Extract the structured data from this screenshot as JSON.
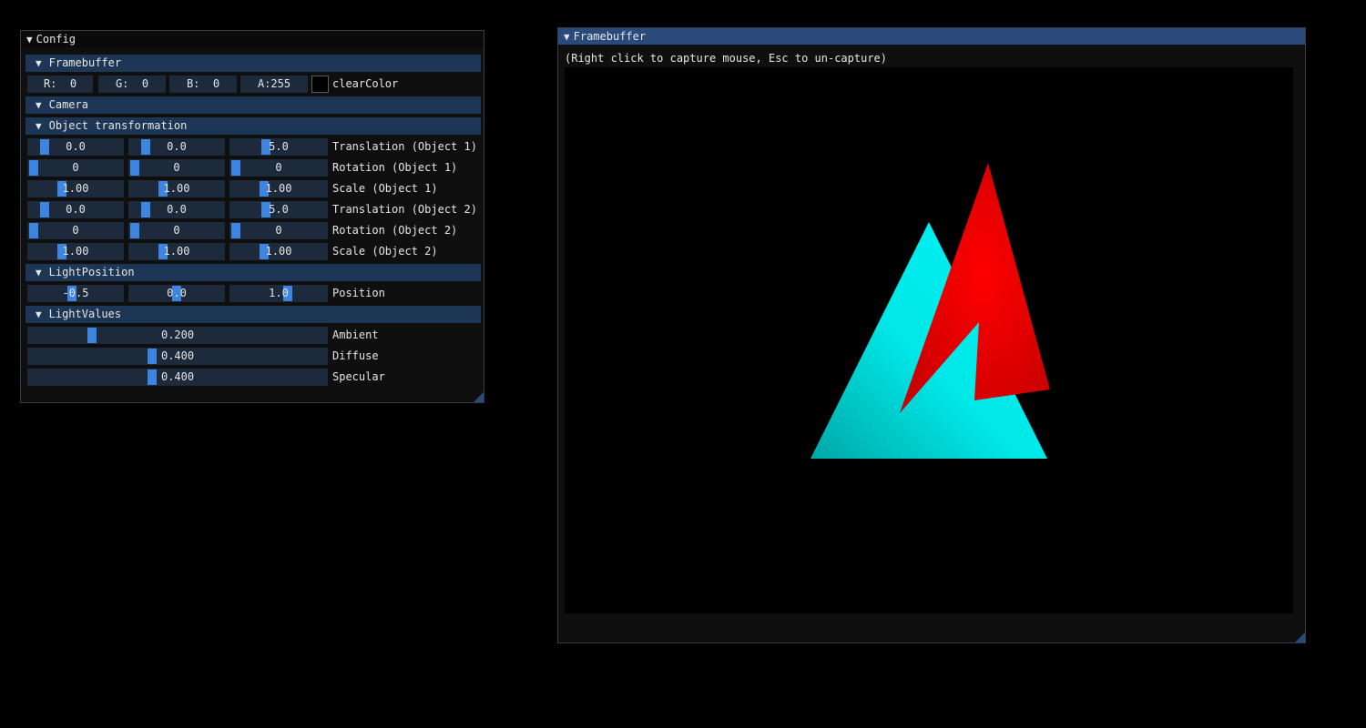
{
  "config": {
    "title": "Config",
    "framebuffer_header": "Framebuffer",
    "clear": {
      "r": "R:  0",
      "g": "G:  0",
      "b": "B:  0",
      "a": "A:255",
      "label": "clearColor"
    },
    "camera_header": "Camera",
    "object_header": "Object transformation",
    "rows": [
      {
        "values": [
          "0.0",
          "0.0",
          "5.0"
        ],
        "label": "Translation (Object 1)"
      },
      {
        "values": [
          "0",
          "0",
          "0"
        ],
        "label": "Rotation (Object 1)"
      },
      {
        "values": [
          "1.00",
          "1.00",
          "1.00"
        ],
        "label": "Scale (Object 1)"
      },
      {
        "values": [
          "0.0",
          "0.0",
          "5.0"
        ],
        "label": "Translation (Object 2)"
      },
      {
        "values": [
          "0",
          "0",
          "0"
        ],
        "label": "Rotation (Object 2)"
      },
      {
        "values": [
          "1.00",
          "1.00",
          "1.00"
        ],
        "label": "Scale (Object 2)"
      }
    ],
    "lightpos_header": "LightPosition",
    "lightpos": {
      "values": [
        "-0.5",
        "0.0",
        "1.0"
      ],
      "label": "Position"
    },
    "lightvalues_header": "LightValues",
    "lights": [
      {
        "value": "0.200",
        "label": "Ambient",
        "level": 0.2
      },
      {
        "value": "0.400",
        "label": "Diffuse",
        "level": 0.4
      },
      {
        "value": "0.400",
        "label": "Specular",
        "level": 0.4
      }
    ]
  },
  "framebuffer": {
    "title": "Framebuffer",
    "hint": "(Right click to capture mouse, Esc to un-capture)",
    "object_colors": {
      "object1": "#00e8e8",
      "object2": "#ff0000"
    }
  },
  "accent": "#3d85e0",
  "header_bg": "#1e3655"
}
